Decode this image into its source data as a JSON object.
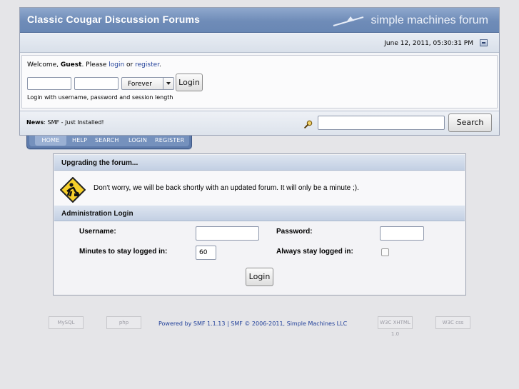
{
  "header": {
    "forum_title": "Classic Cougar Discussion Forums",
    "logo_text": "simple machines forum",
    "date": "June 12, 2011, 05:30:31 PM"
  },
  "login": {
    "welcome_prefix": "Welcome, ",
    "guest": "Guest",
    "please": ". Please ",
    "login_link": "login",
    "or": " or ",
    "register_link": "register",
    "period": ".",
    "session_length": "Forever",
    "button": "Login",
    "hint": "Login with username, password and session length"
  },
  "news": {
    "label": "News",
    "text": ": SMF - Just Installed!"
  },
  "search": {
    "button": "Search"
  },
  "menu": {
    "tabs": [
      "HOME",
      "HELP",
      "SEARCH",
      "LOGIN",
      "REGISTER"
    ],
    "active": "HOME"
  },
  "maintenance": {
    "title": "Upgrading the forum...",
    "message": "Don't worry, we will be back shortly with an updated forum.  It will only be a minute ;)."
  },
  "admin": {
    "title": "Administration Login",
    "username_label": "Username:",
    "password_label": "Password:",
    "minutes_label": "Minutes to stay logged in:",
    "minutes_value": "60",
    "always_label": "Always stay logged in:",
    "always_checked": false,
    "button": "Login"
  },
  "footer": {
    "powered": "Powered by SMF 1.1.13 | SMF © 2006-2011, Simple Machines LLC",
    "badges": {
      "mysql": "MySQL",
      "php": "php",
      "xhtml": "W3C XHTML 1.0",
      "css": "W3C css"
    }
  },
  "colors": {
    "title_bar": "#7892bd",
    "link": "#22419a",
    "menu_tab": "#5e7bab"
  }
}
